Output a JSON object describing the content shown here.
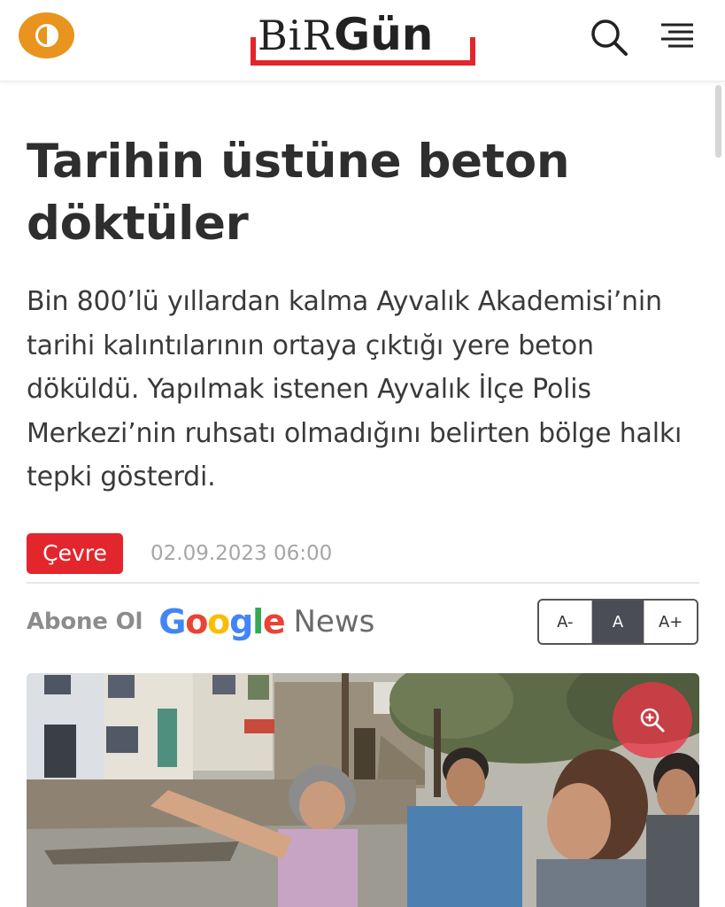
{
  "header": {
    "logo": {
      "part1": "BiR",
      "part2": "Gün"
    },
    "theme_toggle_icon": "half-circle-icon",
    "search_icon": "search-icon",
    "menu_icon": "hamburger-menu-icon",
    "colors": {
      "toggle": "#e8941e",
      "brand_red": "#e3262c"
    }
  },
  "article": {
    "title": "Tarihin üstüne beton döktüler",
    "summary": "Bin 800’lü yıllardan kalma Ayvalık Akademisi’nin tarihi kalıntılarının ortaya çıktığı yere beton döküldü. Yapılmak istenen Ayvalık İlçe Polis Merkezi’nin ruhsatı olmadığını belirten bölge halkı tepki gösterdi.",
    "category": "Çevre",
    "date": "02.09.2023 06:00"
  },
  "follow": {
    "label": "Abone Ol",
    "google_letters": [
      "G",
      "o",
      "o",
      "g",
      "l",
      "e"
    ],
    "google_colors": [
      "#4285f4",
      "#ea4335",
      "#fbbc05",
      "#4285f4",
      "#34a853",
      "#ea4335"
    ],
    "news": "News"
  },
  "font_size": {
    "decrease": "A-",
    "normal": "A",
    "increase": "A+",
    "selected": "A"
  },
  "photo": {
    "zoom_icon": "zoom-in-icon"
  }
}
